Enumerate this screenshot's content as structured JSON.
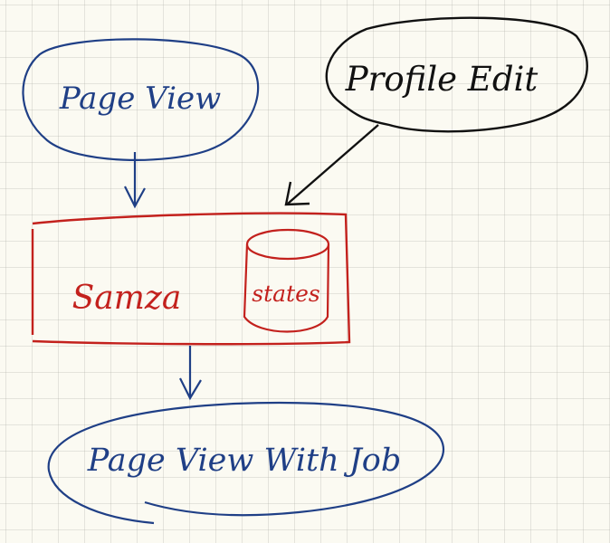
{
  "nodes": {
    "page_view": {
      "label": "Page View"
    },
    "profile_edit": {
      "label": "Profile Edit"
    },
    "samza": {
      "label": "Samza"
    },
    "states": {
      "label": "states"
    },
    "page_view_with_job": {
      "label": "Page View With Job"
    }
  },
  "colors": {
    "blue": "#1f3f86",
    "black": "#111111",
    "red": "#c3211d",
    "paper": "#fbfaf2"
  }
}
